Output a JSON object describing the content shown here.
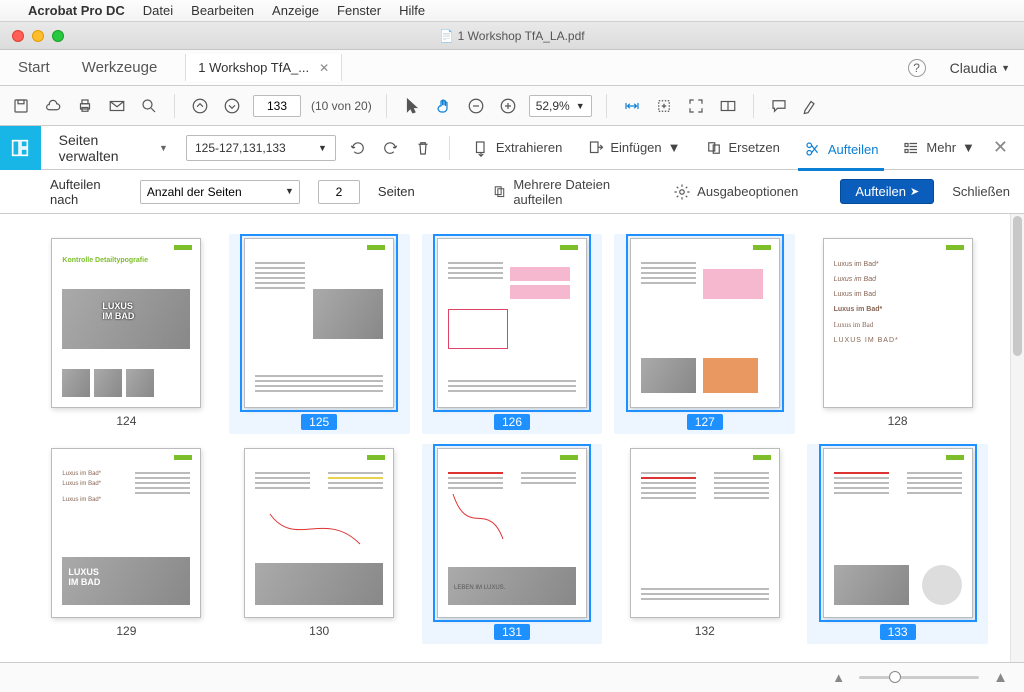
{
  "menubar": {
    "app": "Acrobat Pro DC",
    "items": [
      "Datei",
      "Bearbeiten",
      "Anzeige",
      "Fenster",
      "Hilfe"
    ]
  },
  "title": "1  Workshop TfA_LA.pdf",
  "tabs": {
    "start": "Start",
    "tools": "Werkzeuge",
    "doc": "1  Workshop TfA_..."
  },
  "user": "Claudia",
  "toolbar": {
    "page": "133",
    "count": "(10 von 20)",
    "zoom": "52,9%"
  },
  "section": {
    "manage": "Seiten verwalten",
    "range": "125-127,131,133",
    "extract": "Extrahieren",
    "insert": "Einfügen",
    "replace": "Ersetzen",
    "split": "Aufteilen",
    "more": "Mehr"
  },
  "splitbar": {
    "label": "Aufteilen nach",
    "mode": "Anzahl der Seiten",
    "count": "2",
    "pages_suffix": "Seiten",
    "multi": "Mehrere Dateien aufteilen",
    "output": "Ausgabeoptionen",
    "action": "Aufteilen",
    "close": "Schließen"
  },
  "thumbs": [
    {
      "n": "124",
      "sel": false
    },
    {
      "n": "125",
      "sel": true
    },
    {
      "n": "126",
      "sel": true
    },
    {
      "n": "127",
      "sel": true
    },
    {
      "n": "128",
      "sel": false
    },
    {
      "n": "129",
      "sel": false
    },
    {
      "n": "130",
      "sel": false
    },
    {
      "n": "131",
      "sel": true
    },
    {
      "n": "132",
      "sel": false
    },
    {
      "n": "133",
      "sel": true
    }
  ]
}
